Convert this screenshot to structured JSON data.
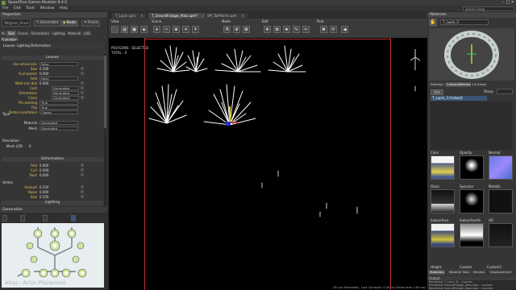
{
  "app": {
    "title": "SpeedTree Games Modeler 8.4.0"
  },
  "menu": [
    "File",
    "Edit",
    "Tools",
    "Window",
    "Help"
  ],
  "search": {
    "placeholder": "Search Help"
  },
  "left": {
    "header": "Properties",
    "item_name": "Tallgrass_Grass",
    "generator_btn": "Generator",
    "node_btn": "Node",
    "frond_btn": "Frond",
    "tabs": [
      "All",
      "Skin",
      "Forces",
      "Orientation",
      "Lighting",
      "Material",
      "LOD",
      "Animation"
    ],
    "collision": "Collision",
    "sub_header": "Leaves: Lighting Deformation",
    "leaves_section": "Leaves",
    "rows": [
      {
        "label": "Use actual size",
        "value": "False",
        "kind": "dd"
      },
      {
        "label": "Size",
        "value": "0.200",
        "kind": "num"
      },
      {
        "label": "% of parent",
        "value": "0.000",
        "kind": "num"
      },
      {
        "label": "Fold",
        "value": "False",
        "kind": "dd"
      },
      {
        "label": "Weld min dist",
        "value": "0.000",
        "kind": "num"
      },
      {
        "label": "Cast",
        "value": "Generated",
        "kind": "dd2"
      },
      {
        "label": "Orientation",
        "value": "Generated",
        "kind": "dd2"
      },
      {
        "label": "Cross",
        "value": "Generated",
        "kind": "dd2"
      },
      {
        "label": "Pin winding",
        "value": "True",
        "kind": "dd"
      },
      {
        "label": "Flip",
        "value": "True",
        "kind": "dd"
      },
      {
        "label": "Detail orientation",
        "value": "Classic",
        "kind": "dd"
      }
    ],
    "type_label": "Type",
    "material_label": "Material",
    "material_value": "Generated",
    "mesh_label": "Mesh",
    "mesh_value": "Generated",
    "resolution_label": "Resolution",
    "mesh_lod_label": "Mesh LOD",
    "mesh_lod_value": "0",
    "deformation_section": "Deformation",
    "deform_rows": [
      {
        "label": "Fold",
        "value": "0.000"
      },
      {
        "label": "Curl",
        "value": "0.000"
      },
      {
        "label": "Twist",
        "value": "0.000"
      }
    ],
    "vertex_label": "Vertex",
    "vertex_rows": [
      {
        "label": "Amount",
        "value": "0.250"
      },
      {
        "label": "Noise",
        "value": "0.000"
      },
      {
        "label": "Size",
        "value": "0.250"
      }
    ],
    "lighting_section": "Lighting"
  },
  "generation": {
    "header": "Generation",
    "tools": [
      "Add",
      "Actions",
      "Distribution",
      "Options"
    ],
    "watermark": "Atlas - Actor Placement"
  },
  "doc_tabs": [
    {
      "label": "T_Lupin.spm",
      "active": false
    },
    {
      "label": "T_GroundFoliage_Atlas.spm*",
      "active": true
    },
    {
      "label": "SM_TallPlants.spm",
      "active": false
    }
  ],
  "toolbar_groups": [
    "View",
    "Scene",
    "Mode",
    "Edit",
    "Post"
  ],
  "viewport": {
    "polygons_label": "POLYGONS : SELECTED",
    "total_label": "TOTAL : 0",
    "status": "(30 cps Moveable), Last Compute: 0.06 ms (Draw time 1.89 ms)"
  },
  "right": {
    "header": "Materials",
    "material_name": "T_Lupin_3",
    "tabs_top": [
      "Settings",
      "Cutouts/Meshes",
      "LX Areas"
    ],
    "cutout_name": "T_Lupin_3 (Cutout)",
    "add_btn": "Add",
    "sharp_label": "Sharp",
    "maps": [
      {
        "label": "Color"
      },
      {
        "label": "Opacity"
      },
      {
        "label": "Normal"
      },
      {
        "label": "Gloss"
      },
      {
        "label": "Specular"
      },
      {
        "label": "Metallic"
      },
      {
        "label": "Subsurface"
      },
      {
        "label": "Subsurface%"
      },
      {
        "label": "AO"
      }
    ],
    "bottom_labels": [
      "Height",
      "Custom",
      "Custom2"
    ],
    "bottom_tabs": [
      "Materials",
      "Material Sets",
      "Meshes",
      "Displacement"
    ],
    "output_header": "Output",
    "output_lines": [
      "Rendering T_Lupin_3/... success",
      "Rendering GroundFoliage_Atlas.spm... success",
      "Rendering GroundFoliage_Atlas.spm... success"
    ]
  },
  "colors": {
    "accent": "#e0c24a",
    "selection": "#3a5575",
    "viewport_bg": "#000000"
  }
}
